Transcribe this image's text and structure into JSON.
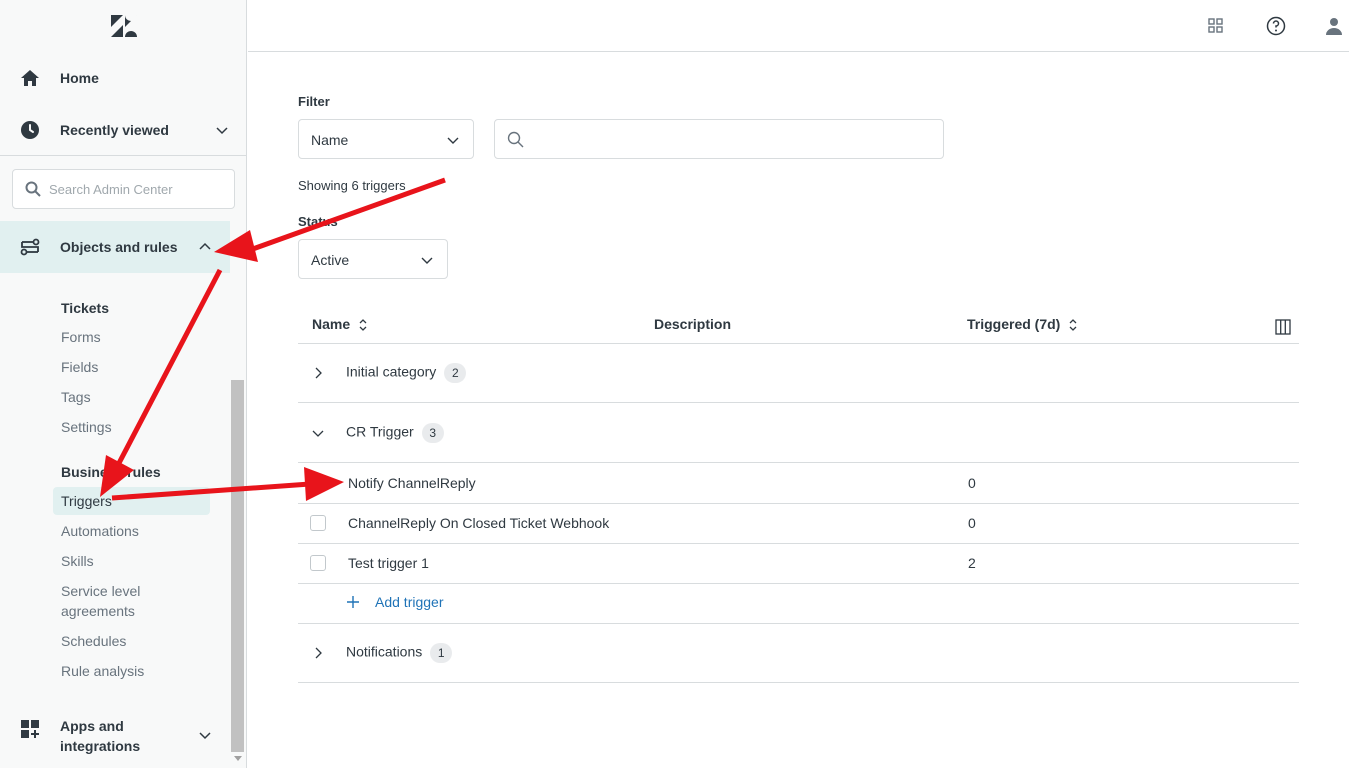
{
  "sidebar": {
    "home_label": "Home",
    "recently_viewed_label": "Recently viewed",
    "search_placeholder": "Search Admin Center",
    "objects_rules_label": "Objects and rules",
    "tickets_heading": "Tickets",
    "ticket_items": [
      "Forms",
      "Fields",
      "Tags",
      "Settings"
    ],
    "business_rules_heading": "Business rules",
    "business_items": [
      "Triggers",
      "Automations",
      "Skills",
      "Service level agreements",
      "Schedules",
      "Rule analysis"
    ],
    "apps_label_line1": "Apps and",
    "apps_label_line2": "integrations"
  },
  "main": {
    "filter_label": "Filter",
    "filter_select_value": "Name",
    "showing_text": "Showing 6 triggers",
    "status_label": "Status",
    "status_value": "Active",
    "columns": {
      "name": "Name",
      "description": "Description",
      "triggered": "Triggered (7d)"
    },
    "groups": [
      {
        "name": "Initial category",
        "count": "2",
        "expanded": false
      },
      {
        "name": "CR Trigger",
        "count": "3",
        "expanded": true
      },
      {
        "name": "Notifications",
        "count": "1",
        "expanded": false
      }
    ],
    "triggers": [
      {
        "name": "Notify ChannelReply",
        "triggered": "0"
      },
      {
        "name": "ChannelReply On Closed Ticket Webhook",
        "triggered": "0"
      },
      {
        "name": "Test trigger 1",
        "triggered": "2"
      }
    ],
    "add_trigger_label": "Add trigger"
  },
  "colors": {
    "accent_red": "#e8141b",
    "selected_bg": "#e1f0f0",
    "link_blue": "#1f73b7"
  }
}
